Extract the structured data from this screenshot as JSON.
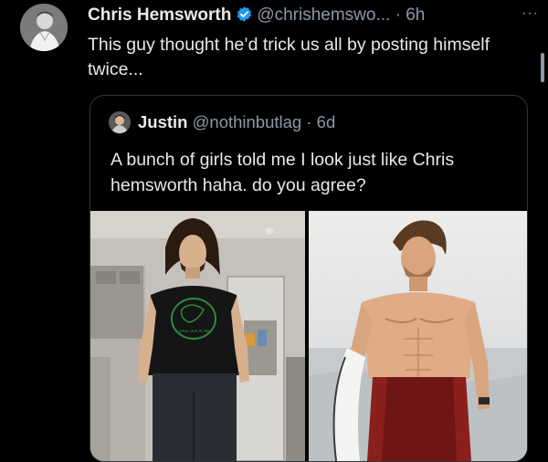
{
  "tweet": {
    "author_name": "Chris Hemsworth",
    "author_handle": "@chrishemswo...",
    "separator": "·",
    "time": "6h",
    "more": "···",
    "text": "This guy thought he’d trick us all by posting himself twice..."
  },
  "quote": {
    "author_name": "Justin",
    "author_handle": "@nothinbutlag",
    "separator": "·",
    "time": "6d",
    "text": "A bunch of girls told me I look just like Chris hemsworth haha. do you agree?",
    "shirt_print": "SAVE OUR PLANET"
  },
  "icons": {
    "verified": "verified-badge-icon",
    "more": "more-options-icon"
  },
  "colors": {
    "background": "#000000",
    "text": "#e7e9ea",
    "secondary": "#8b98a5",
    "verified": "#1d9bf0",
    "border": "#2f3336",
    "shirt_print": "#2e8b3c"
  }
}
